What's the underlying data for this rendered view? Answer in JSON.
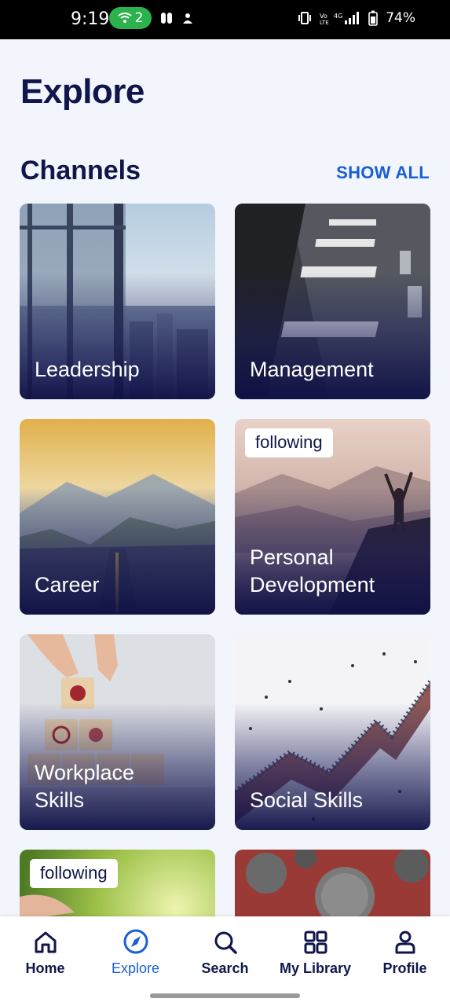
{
  "status_bar": {
    "time": "9:19",
    "hotspot_count": "2",
    "battery": "74%"
  },
  "header": {
    "title": "Explore"
  },
  "channels": {
    "title": "Channels",
    "show_all": "SHOW ALL",
    "items": [
      {
        "label": "Leadership",
        "badge": ""
      },
      {
        "label": "Management",
        "badge": ""
      },
      {
        "label": "Career",
        "badge": ""
      },
      {
        "label": "Personal\nDevelopment",
        "badge": "following"
      },
      {
        "label": "Workplace\nSkills",
        "badge": ""
      },
      {
        "label": "Social Skills",
        "badge": ""
      },
      {
        "label": "",
        "badge": "following"
      },
      {
        "label": "",
        "badge": ""
      }
    ]
  },
  "nav": {
    "items": [
      {
        "label": "Home",
        "icon": "home-icon"
      },
      {
        "label": "Explore",
        "icon": "compass-icon",
        "active": true
      },
      {
        "label": "Search",
        "icon": "search-icon"
      },
      {
        "label": "My Library",
        "icon": "grid-icon"
      },
      {
        "label": "Profile",
        "icon": "profile-icon"
      }
    ]
  },
  "colors": {
    "primary_text": "#10164a",
    "accent": "#1a5fd0",
    "background": "#f2f5fb"
  }
}
